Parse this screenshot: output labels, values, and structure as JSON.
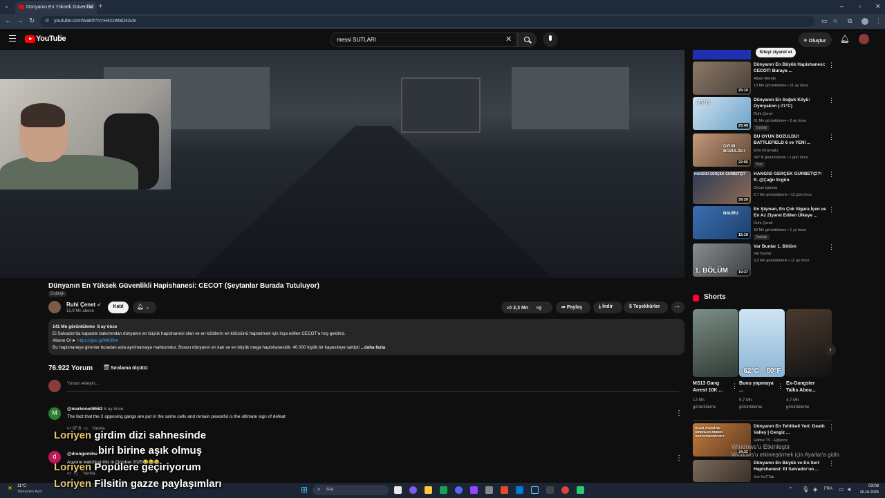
{
  "browser": {
    "tab_title": "Dünyanın En Yüksek Güvenlikli",
    "url": "youtube.com/watch?v=H4zzWaD4A4s"
  },
  "header": {
    "logo_text": "YouTube",
    "country": "FR",
    "search_value": "messi SUTLARI",
    "create_label": "Oluştur"
  },
  "video": {
    "title": "Dünyanın En Yüksek Güvenlikli Hapishanesi: CECOT (Şeytanlar Burada Tutuluyor)",
    "dub_badge": "Dublajlı",
    "channel": "Ruhi Çenet",
    "subscribers": "15,9 Mn abone",
    "join_label": "Katıl",
    "likes": "2,3 Mn",
    "share_label": "Paylaş",
    "download_label": "İndir",
    "thanks_label": "Teşekkürler"
  },
  "description": {
    "views": "141 Mn görüntüleme",
    "ago": "8 ay önce",
    "line1": "El Salvador'da kapasite bakımından dünyanın en büyük hapishanesi olan ve en kötülerin en kötüsünü hapsetmek için inşa edilen CECOT'a hoş geldiniz.",
    "line2_prefix": "Abone Ol ►",
    "line2_link": "https://goo.gl/MKi8tm",
    "line3": "Bu hapishaneye girenler buradan asla ayrılmamaya mahkumdur. Burası dünyanın en katı ve en büyük mega hapishanesidir. 40.000 kişilik bir kapasiteye sahipti",
    "more_label": "...daha fazla"
  },
  "comments": {
    "count": "76.922 Yorum",
    "sort_label": "Sıralama ölçütü:",
    "add_placeholder": "Yorum ekleyin...",
    "items": [
      {
        "initial": "M",
        "user": "@markoneil6562",
        "time": "8 ay önce",
        "text": "The fact that the 2 opposing gangs are put in the same cells and remain peaceful is the ultimate sign of defeat",
        "likes": "87 B",
        "reply": "Yanıtla"
      },
      {
        "initial": "d",
        "user": "@drengomihu",
        "time": "",
        "text": "Anyone watching this in October 2025😂😂😂",
        "likes": "",
        "reply": "Yanıtla"
      }
    ]
  },
  "overlay": {
    "lines": [
      {
        "name": "Loriyen",
        "text": "girdim dizi sahnesinde"
      },
      {
        "name": "",
        "text": "biri birine aşık olmuş"
      },
      {
        "name": "Loriyen",
        "text": "Popülere geçiriyorum"
      },
      {
        "name": "Loriyen",
        "text": "Filsitin gazze paylaşımları"
      }
    ]
  },
  "sidebar": {
    "visit_label": "Siteyi ziyaret et",
    "items": [
      {
        "title": "Dünyanın En Büyük Hapishanesi: CECOT! Buraya ...",
        "channel": "Albert Rende",
        "meta": "13 Mn görüntüleme • 11 ay önce",
        "duration": "25:10",
        "badge": ""
      },
      {
        "title": "Dünyanın En Soğuk Köyü: Oymyakon (-71°C)",
        "channel": "Ruhi Çenet",
        "meta": "61 Mn görüntüleme • 3 ay önce",
        "duration": "25:49",
        "badge": "Dublajlı"
      },
      {
        "title": "BU OYUN BOZULDU! BATTLEFIELD 6 ve YENİ ...",
        "channel": "Enis Kirazoglu",
        "meta": "347 B görüntüleme • 1 gün önce",
        "duration": "22:55",
        "badge": "Yeni"
      },
      {
        "title": "HANGİSİ GERÇEK GURBETÇİ?! ft. @Çağrı Ergün",
        "channel": "Orkun Işıtmak",
        "meta": "2,7 Mn görüntüleme • 12 gün önce",
        "duration": "39:20",
        "badge": ""
      },
      {
        "title": "En Şişman, En Çok Sigara İçen ve En Az Ziyaret Edilen Ülkeye ...",
        "channel": "Ruhi Çenet",
        "meta": "59 Mn görüntüleme • 1 yıl önce",
        "duration": "15:19",
        "badge": "Dublajlı"
      },
      {
        "title": "Var Bunlar 1. Bölüm",
        "channel": "Var Bunlar",
        "meta": "3,2 Mn görüntüleme • 11 ay önce",
        "duration": "19:37",
        "badge": ""
      }
    ],
    "shorts_title": "Shorts",
    "shorts": [
      {
        "title": "MS13 Gang Arrest 10K ...",
        "views": "12 Mn görüntüleme"
      },
      {
        "title": "Bunu yapmaya ...",
        "views": "5,7 Mn görüntüleme"
      },
      {
        "title": "Ex-Gangster Talks Abou...",
        "views": "4,7 Mn görüntüleme"
      }
    ],
    "items2": [
      {
        "title": "Dünyanın En Tehlikeli Yeri: Death Valley | Cengiz ...",
        "channel": "Rafine TV - Eğlence",
        "meta": "",
        "duration": "34:22"
      },
      {
        "title": "Dünyanın En Büyük ve En Sert Hapishanesi: El Salvador'un ...",
        "channel": "Joe HaTTab",
        "meta": "",
        "duration": ""
      }
    ],
    "short_temps": [
      "-62°C",
      "-80°F"
    ],
    "thumb_texts": {
      "oyun": "OYUN BOZULDU!",
      "hangisi": "HANGİSİ GERÇEK GURBETÇİ?",
      "nauru": "NAURU",
      "bolum": "1. BÖLÜM",
      "olum": "ÖLÜM VADİSİ'NE GİRENLER NEDEN GERİ DÖNEMİYOR?",
      "temp": "-71°C"
    }
  },
  "windows": {
    "activate_title": "Windows'u Etkinleştir",
    "activate_sub": "Windows'u etkinleştirmek için Ayarlar'a gidin.",
    "weather_temp": "11°C",
    "weather_desc": "Tamamen Açık",
    "search_label": "Ara",
    "lang": "FRA",
    "time": "03:08",
    "date": "16.10.2025"
  }
}
